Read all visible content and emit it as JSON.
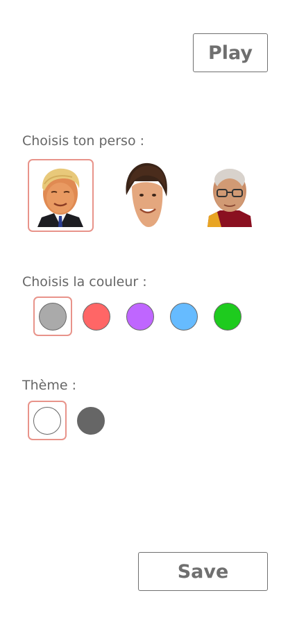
{
  "toolbar": {
    "play_label": "Play",
    "save_label": "Save"
  },
  "character_section": {
    "label": "Choisis ton perso :",
    "selected_index": 0,
    "characters": [
      {
        "icon": "portrait-blond-man-icon"
      },
      {
        "icon": "portrait-dark-hair-man-icon"
      },
      {
        "icon": "portrait-monk-glasses-icon"
      }
    ]
  },
  "color_section": {
    "label": "Choisis la couleur :",
    "selected_index": 0,
    "colors": [
      "#aaaaaa",
      "#ff6666",
      "#bf66ff",
      "#66bbff",
      "#1ecb1e"
    ]
  },
  "theme_section": {
    "label": "Thème :",
    "selected_index": 0,
    "themes": [
      "#ffffff",
      "#666666"
    ]
  },
  "accent_color": "#e8938a"
}
